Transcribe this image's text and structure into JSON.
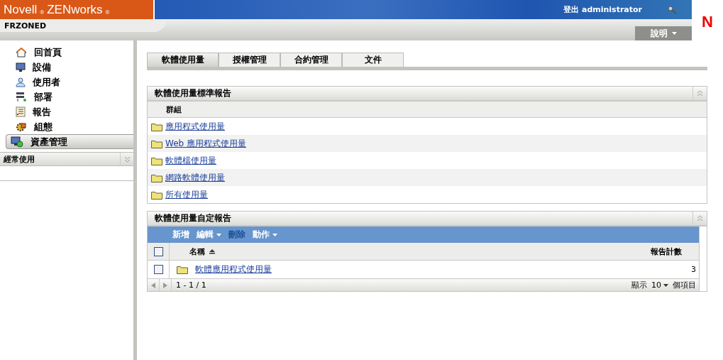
{
  "header": {
    "brand": "Novell",
    "brand_mark": "®",
    "product": "ZENworks",
    "product_mark": "®",
    "logout": "登出 administrator",
    "zone": "FRZONED",
    "help": "說明",
    "logo_letter": "N"
  },
  "sidebar": {
    "items": [
      {
        "label": "回首頁",
        "selected": false
      },
      {
        "label": "設備",
        "selected": false
      },
      {
        "label": "使用者",
        "selected": false
      },
      {
        "label": "部署",
        "selected": false
      },
      {
        "label": "報告",
        "selected": false
      },
      {
        "label": "組態",
        "selected": false
      },
      {
        "label": "資產管理",
        "selected": true
      }
    ],
    "section": {
      "title": "經常使用",
      "expanded": false
    }
  },
  "tabs": [
    {
      "label": "軟體使用量",
      "selected": true
    },
    {
      "label": "授權管理",
      "selected": false
    },
    {
      "label": "合約管理",
      "selected": false
    },
    {
      "label": "文件",
      "selected": false
    }
  ],
  "standard_panel": {
    "title": "軟體使用量標準報告",
    "column": "群組",
    "rows": [
      {
        "label": "應用程式使用量"
      },
      {
        "label": "Web 應用程式使用量"
      },
      {
        "label": "軟體檔使用量"
      },
      {
        "label": "網路軟體使用量"
      },
      {
        "label": "所有使用量"
      }
    ]
  },
  "custom_panel": {
    "title": "軟體使用量自定報告",
    "toolbar": [
      {
        "label": "新增",
        "menu": false,
        "disabled": false
      },
      {
        "label": "編輯",
        "menu": true,
        "disabled": false
      },
      {
        "label": "刪除",
        "menu": false,
        "disabled": true
      },
      {
        "label": "動作",
        "menu": true,
        "disabled": false
      }
    ],
    "columns": [
      "名稱",
      "報告計數"
    ],
    "header_checked": false,
    "rows": [
      {
        "name": "軟體應用程式使用量",
        "count": "3",
        "checked": false
      }
    ],
    "pager": {
      "range": "1 - 1 / 1",
      "show": "顯示",
      "page_size": "10",
      "items": "個項目"
    }
  }
}
